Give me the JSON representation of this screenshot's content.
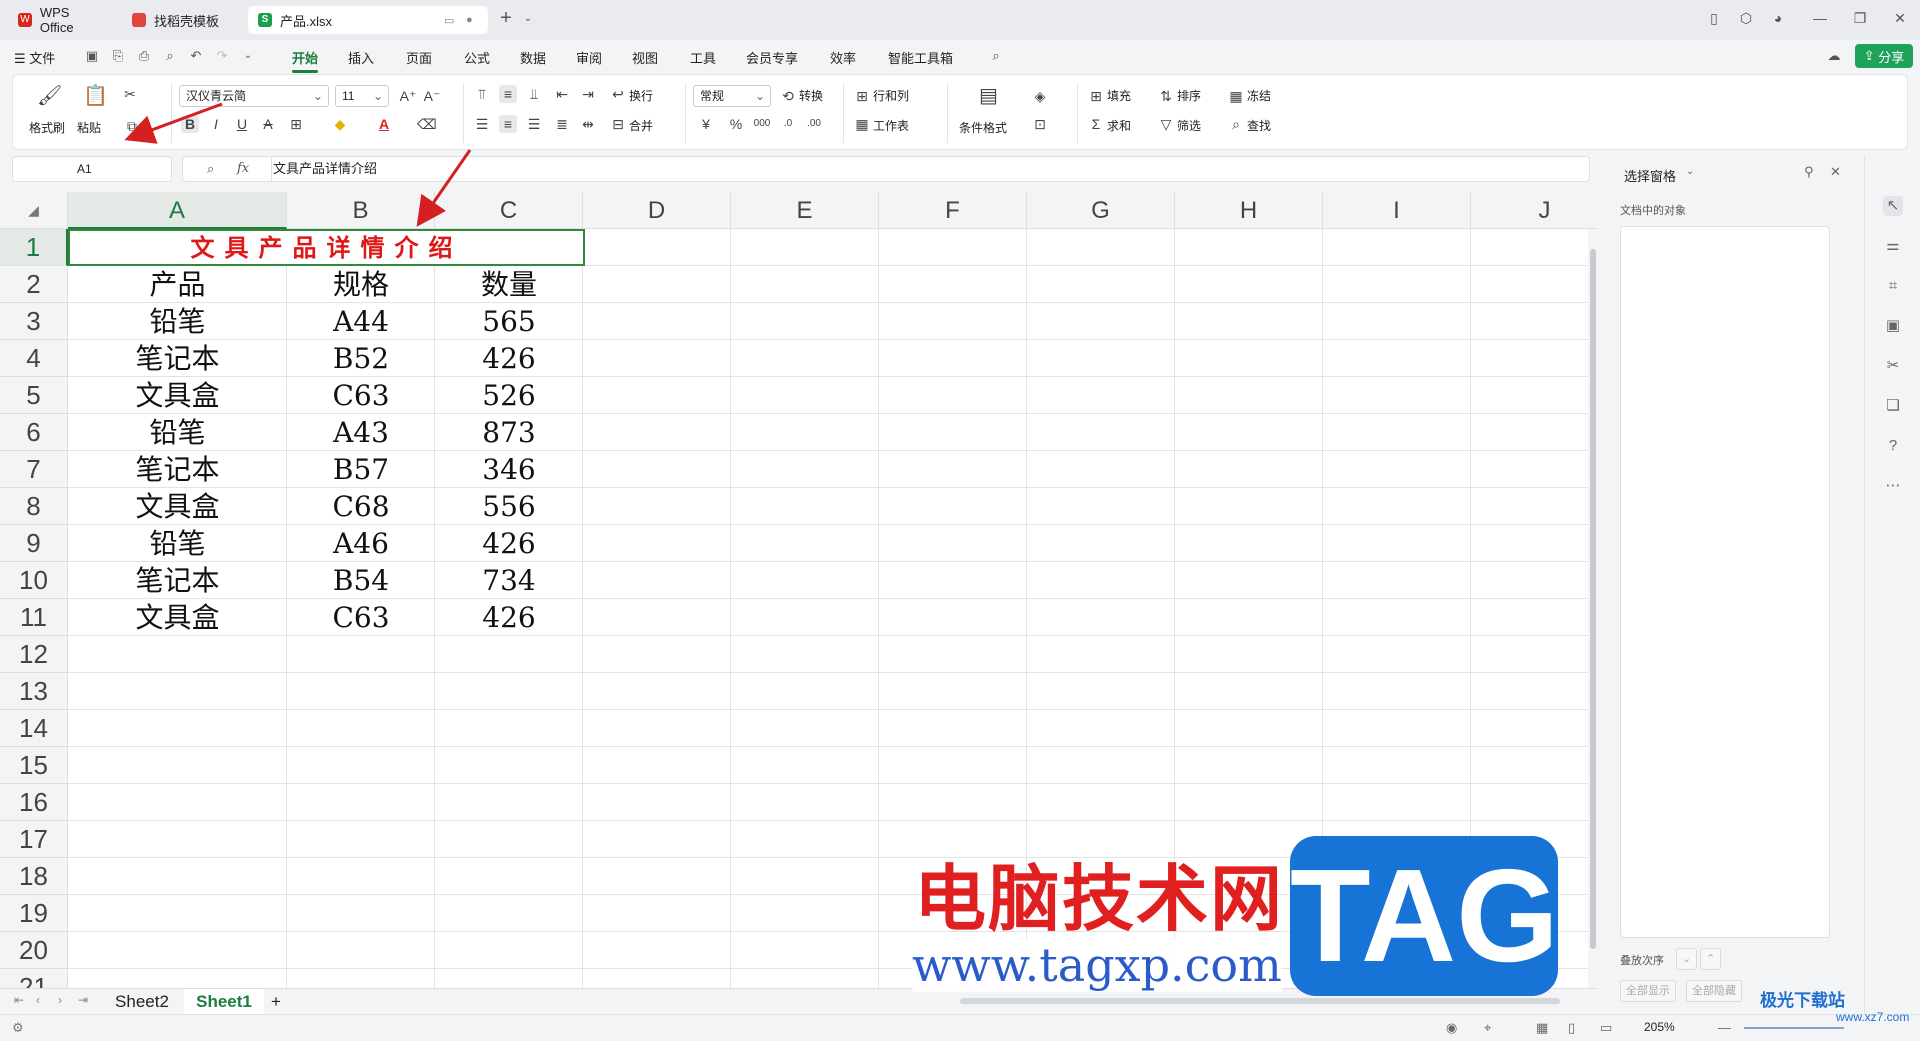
{
  "titlebar": {
    "tabs": [
      {
        "label": "WPS Office",
        "color": "#d9261c"
      },
      {
        "label": "找稻壳模板",
        "color": "#e0443a"
      },
      {
        "label": "产品.xlsx",
        "color": "#1b9e50"
      }
    ]
  },
  "menubar": {
    "file": "文件",
    "items": [
      "开始",
      "插入",
      "页面",
      "公式",
      "数据",
      "审阅",
      "视图",
      "工具",
      "会员专享",
      "效率",
      "智能工具箱"
    ],
    "active": "开始",
    "share": "分享"
  },
  "ribbon": {
    "format_painter": "格式刷",
    "paste": "粘贴",
    "font_name": "汉仪青云简",
    "font_size": "11",
    "wrap": "换行",
    "merge": "合并",
    "number_format": "常规",
    "convert": "转换",
    "rows_cols": "行和列",
    "worksheet": "工作表",
    "conditional_format": "条件格式",
    "fill": "填充",
    "sort": "排序",
    "freeze": "冻结",
    "sum": "求和",
    "filter": "筛选",
    "find": "查找"
  },
  "formula_bar": {
    "name_box": "A1",
    "fx_label": "fx",
    "formula": "文具产品详情介绍"
  },
  "sheet": {
    "columns": [
      "A",
      "B",
      "C",
      "D",
      "E",
      "F",
      "G",
      "H",
      "I",
      "J"
    ],
    "rows": [
      "1",
      "2",
      "3",
      "4",
      "5",
      "6",
      "7",
      "8",
      "9",
      "10",
      "11",
      "12",
      "13",
      "14",
      "15",
      "16",
      "17",
      "18",
      "19",
      "20",
      "21"
    ],
    "title": "文具产品详情介绍",
    "headers": [
      "产品",
      "规格",
      "数量"
    ],
    "data": [
      [
        "铅笔",
        "A44",
        "565"
      ],
      [
        "笔记本",
        "B52",
        "426"
      ],
      [
        "文具盒",
        "C63",
        "526"
      ],
      [
        "铅笔",
        "A43",
        "873"
      ],
      [
        "笔记本",
        "B57",
        "346"
      ],
      [
        "文具盒",
        "C68",
        "556"
      ],
      [
        "铅笔",
        "A46",
        "426"
      ],
      [
        "笔记本",
        "B54",
        "734"
      ],
      [
        "文具盒",
        "C63",
        "426"
      ]
    ]
  },
  "sheet_tabs": [
    "Sheet2",
    "Sheet1"
  ],
  "active_sheet": "Sheet1",
  "pane": {
    "title": "选择窗格",
    "subtitle": "文档中的对象",
    "order_label": "叠放次序",
    "show_all": "全部显示",
    "hide_all": "全部隐藏"
  },
  "statusbar": {
    "zoom": "205%"
  },
  "watermark": {
    "cn": "电脑技术网",
    "url": "www.tagxp.com",
    "tag": "TAG",
    "brand": "极光下载站",
    "brand_url": "www.xz7.com"
  }
}
